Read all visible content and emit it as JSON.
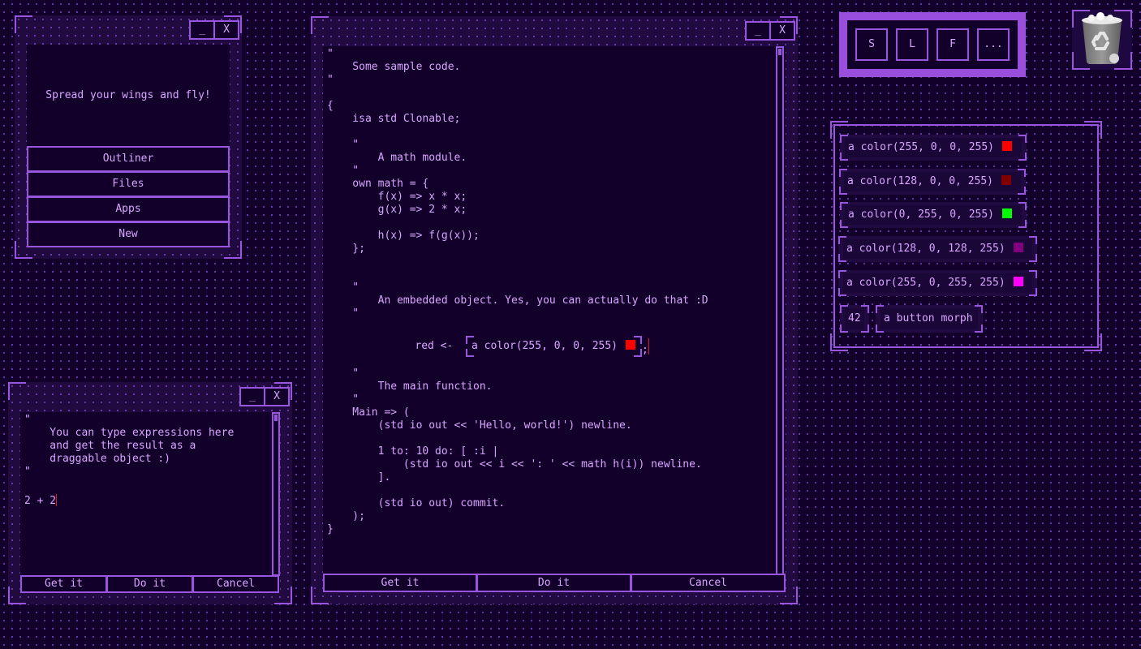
{
  "launcher_window": {
    "minimize_label": "_",
    "close_label": "X",
    "slogan": "Spread your wings and fly!",
    "menu_items": [
      {
        "label": "Outliner"
      },
      {
        "label": "Files"
      },
      {
        "label": "Apps"
      },
      {
        "label": "New"
      }
    ]
  },
  "code_window": {
    "minimize_label": "_",
    "close_label": "X",
    "code_before": "\"\n    Some sample code.\n\"\n\n{\n    isa std Clonable;\n\n    \"\n        A math module.\n    \"\n    own math = {\n        f(x) => x * x;\n        g(x) => 2 * x;\n\n        h(x) => f(g(x));\n    };\n\n\n    \"\n        An embedded object. Yes, you can actually do that :D\n    \"",
    "embed_prefix": "    red <-  ",
    "embedded_object": {
      "label": "a color(255, 0, 0, 255)",
      "color": "#ff0000"
    },
    "embed_suffix": ";",
    "code_after": "\n\n    \"\n        The main function.\n    \"\n    Main => (\n        (std io out << 'Hello, world!') newline.\n\n        1 to: 10 do: [ :i |\n            (std io out << i << ': ' << math h(i)) newline.\n        ].\n\n        (std io out) commit.\n    );\n}",
    "buttons": {
      "get_it": "Get it",
      "do_it": "Do it",
      "cancel": "Cancel"
    }
  },
  "repl_window": {
    "minimize_label": "_",
    "close_label": "X",
    "text": "\"\n    You can type expressions here\n    and get the result as a\n    draggable object :)\n\"\n\n",
    "input_line": "2 + 2",
    "buttons": {
      "get_it": "Get it",
      "do_it": "Do it",
      "cancel": "Cancel"
    }
  },
  "dock": {
    "buttons": [
      {
        "label": "S"
      },
      {
        "label": "L"
      },
      {
        "label": "F"
      },
      {
        "label": "..."
      }
    ]
  },
  "trash": {
    "icon": "recycle-bin-icon"
  },
  "object_tray": {
    "colors": [
      {
        "label": "a color(255, 0, 0, 255)",
        "color": "#ff0000"
      },
      {
        "label": "a color(128, 0, 0, 255)",
        "color": "#800000"
      },
      {
        "label": "a color(0, 255, 0, 255)",
        "color": "#00ff00"
      },
      {
        "label": "a color(128, 0, 128, 255)",
        "color": "#800080"
      },
      {
        "label": "a color(255, 0, 255, 255)",
        "color": "#ff00ff"
      }
    ],
    "number_morph": "42",
    "button_morph": "a button morph"
  }
}
